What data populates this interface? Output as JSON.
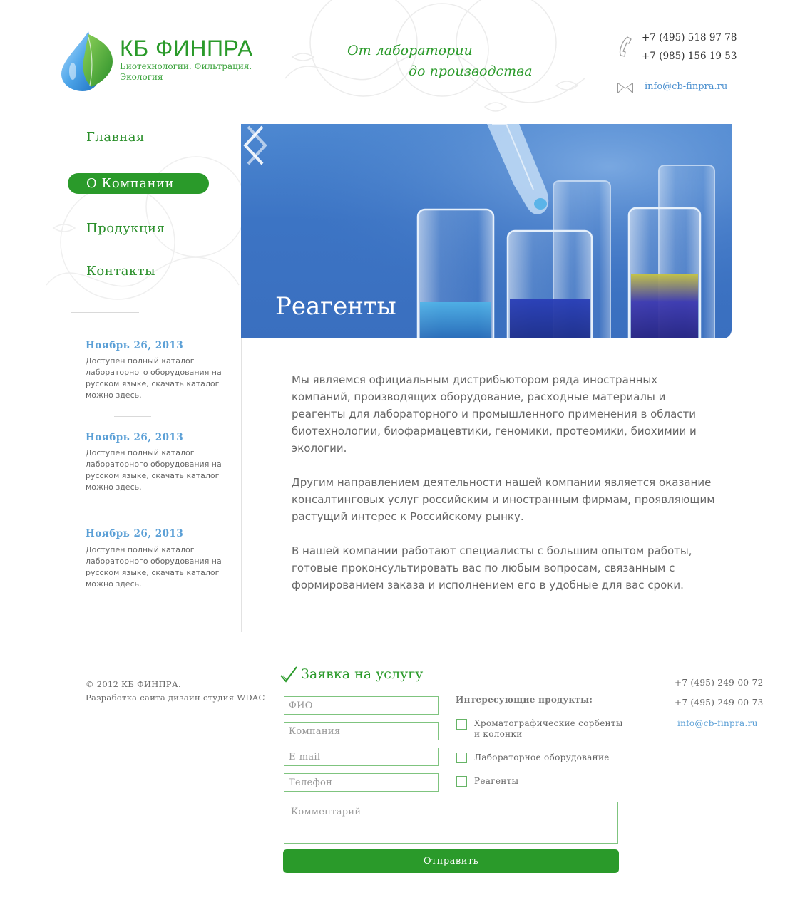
{
  "header": {
    "logo_name": "КБ ФИНПРА",
    "logo_tagline": "Биотехнологии. Фильтрация. Экология",
    "slogan_line1": "От лаборатории",
    "slogan_line2": "до производства",
    "phone1": "+7 (495) 518 97 78",
    "phone2": "+7 (985) 156 19 53",
    "email": "info@cb-finpra.ru"
  },
  "nav": {
    "items": [
      {
        "label": "Главная",
        "active": false
      },
      {
        "label": "О Компании",
        "active": true
      },
      {
        "label": "Продукция",
        "active": false
      },
      {
        "label": "Контакты",
        "active": false
      }
    ]
  },
  "news": [
    {
      "date": "Ноябрь 26, 2013",
      "text": "Доступен полный каталог лабораторного оборудования на русском языке, скачать каталог можно здесь."
    },
    {
      "date": "Ноябрь 26, 2013",
      "text": "Доступен полный каталог лабораторного оборудования на русском языке, скачать каталог можно здесь."
    },
    {
      "date": "Ноябрь 26, 2013",
      "text": "Доступен полный каталог лабораторного оборудования на русском языке, скачать каталог можно здесь."
    }
  ],
  "slider": {
    "caption": "Реагенты",
    "prev_icon": "chevron-left-icon",
    "next_icon": "chevron-right-icon"
  },
  "content": {
    "paragraphs": [
      "Мы являемся официальным дистрибьютором ряда иностранных компаний, производящих оборудование, расходные материалы и реагенты для лабораторного и промышленного применения в области биотехнологии, биофармацевтики, геномики, протеомики, биохимии и экологии.",
      "Другим направлением деятельности нашей компании является оказание консалтинговых услуг российским и иностранным фирмам, проявляющим растущий интерес к Российскому рынку.",
      "В нашей компании работают специалисты с большим опытом работы, готовые проконсультировать вас по любым вопросам, связанным с формированием заказа и исполнением его в удобные для вас сроки."
    ]
  },
  "footer": {
    "copyright": "© 2012 КБ ФИНПРА.",
    "developer": "Разработка сайта дизайн студия WDAC",
    "phone1": "+7 (495) 249-00-72",
    "phone2": "+7 (495) 249-00-73",
    "email": "info@cb-finpra.ru"
  },
  "form": {
    "title": "Заявка на услугу",
    "fio_placeholder": "ФИО",
    "company_placeholder": "Компания",
    "email_placeholder": "E-mail",
    "phone_placeholder": "Телефон",
    "comment_placeholder": "Комментарий",
    "products_label": "Интересующие продукты:",
    "options": [
      {
        "label": "Хроматографические сорбенты и колонки",
        "checked": false
      },
      {
        "label": "Лабораторное оборудование",
        "checked": false
      },
      {
        "label": "Реагенты",
        "checked": false
      }
    ],
    "submit_label": "Отправить"
  },
  "colors": {
    "brand_green": "#2a9a2a",
    "link_blue": "#5a9fd6",
    "slider_blue": "#3c74c4"
  }
}
